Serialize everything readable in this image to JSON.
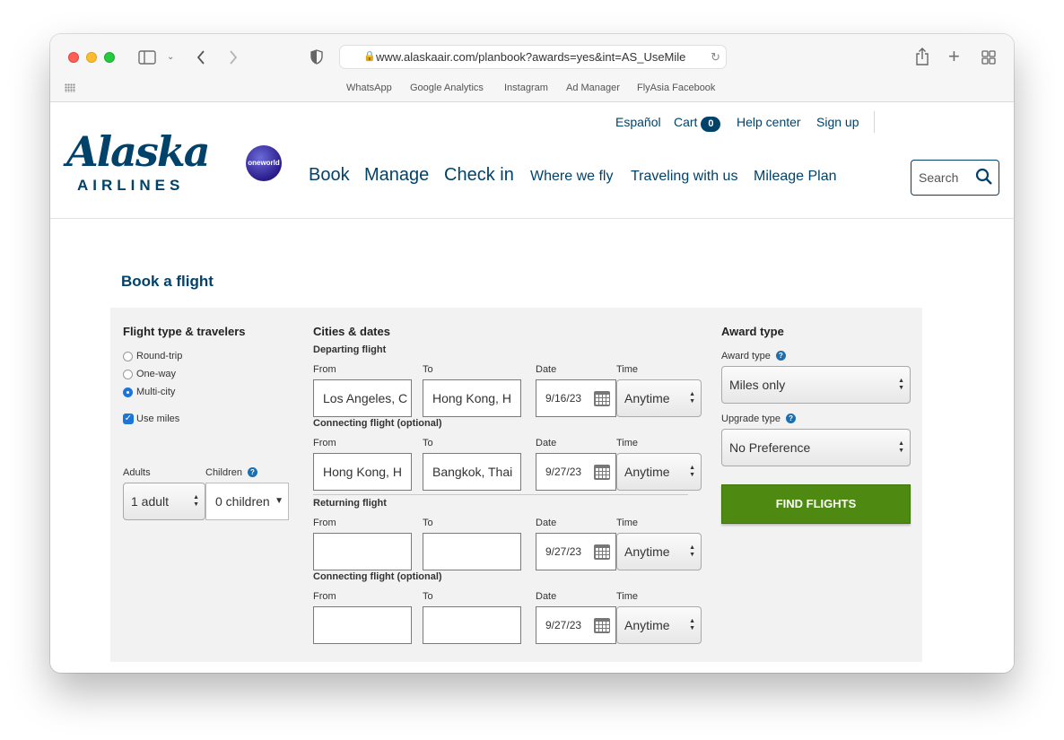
{
  "browser": {
    "url": "www.alaskaair.com/planbook?awards=yes&int=AS_UseMile",
    "bookmarks": [
      "WhatsApp",
      "Google Analytics",
      "Instagram",
      "Ad Manager",
      "FlyAsia Facebook"
    ]
  },
  "header": {
    "logo_main": "Alaska",
    "logo_sub": "AIRLINES",
    "oneworld": "oneworld",
    "utility": {
      "espanol": "Español",
      "cart": "Cart",
      "cart_count": "0",
      "help": "Help center",
      "signup": "Sign up"
    },
    "nav": {
      "book": "Book",
      "manage": "Manage",
      "checkin": "Check in",
      "where": "Where we fly",
      "traveling": "Traveling with us",
      "mileage": "Mileage Plan"
    },
    "search_placeholder": "Search"
  },
  "page_title": "Book a flight",
  "travelers": {
    "title": "Flight type & travelers",
    "options": [
      "Round-trip",
      "One-way",
      "Multi-city"
    ],
    "selected": "Multi-city",
    "use_miles": "Use miles",
    "adults_label": "Adults",
    "children_label": "Children",
    "adults_value": "1 adult",
    "children_value": "0 children"
  },
  "cities": {
    "title": "Cities & dates",
    "col_from": "From",
    "col_to": "To",
    "col_date": "Date",
    "col_time": "Time",
    "segments": [
      {
        "heading": "Departing flight",
        "from": "Los Angeles, C",
        "to": "Hong Kong, H",
        "date": "9/16/23",
        "time": "Anytime"
      },
      {
        "heading": "Connecting flight (optional)",
        "from": "Hong Kong, H",
        "to": "Bangkok, Thai",
        "date": "9/27/23",
        "time": "Anytime"
      },
      {
        "heading": "Returning flight",
        "from": "",
        "to": "",
        "date": "9/27/23",
        "time": "Anytime"
      },
      {
        "heading": "Connecting flight (optional)",
        "from": "",
        "to": "",
        "date": "9/27/23",
        "time": "Anytime"
      }
    ]
  },
  "award": {
    "title": "Award type",
    "award_label": "Award type",
    "award_value": "Miles only",
    "upgrade_label": "Upgrade type",
    "upgrade_value": "No Preference",
    "find_button": "FIND FLIGHTS"
  },
  "colors": {
    "brand_navy": "#01426a",
    "find_green": "#4e8a12",
    "panel_gray": "#f2f2f2"
  }
}
